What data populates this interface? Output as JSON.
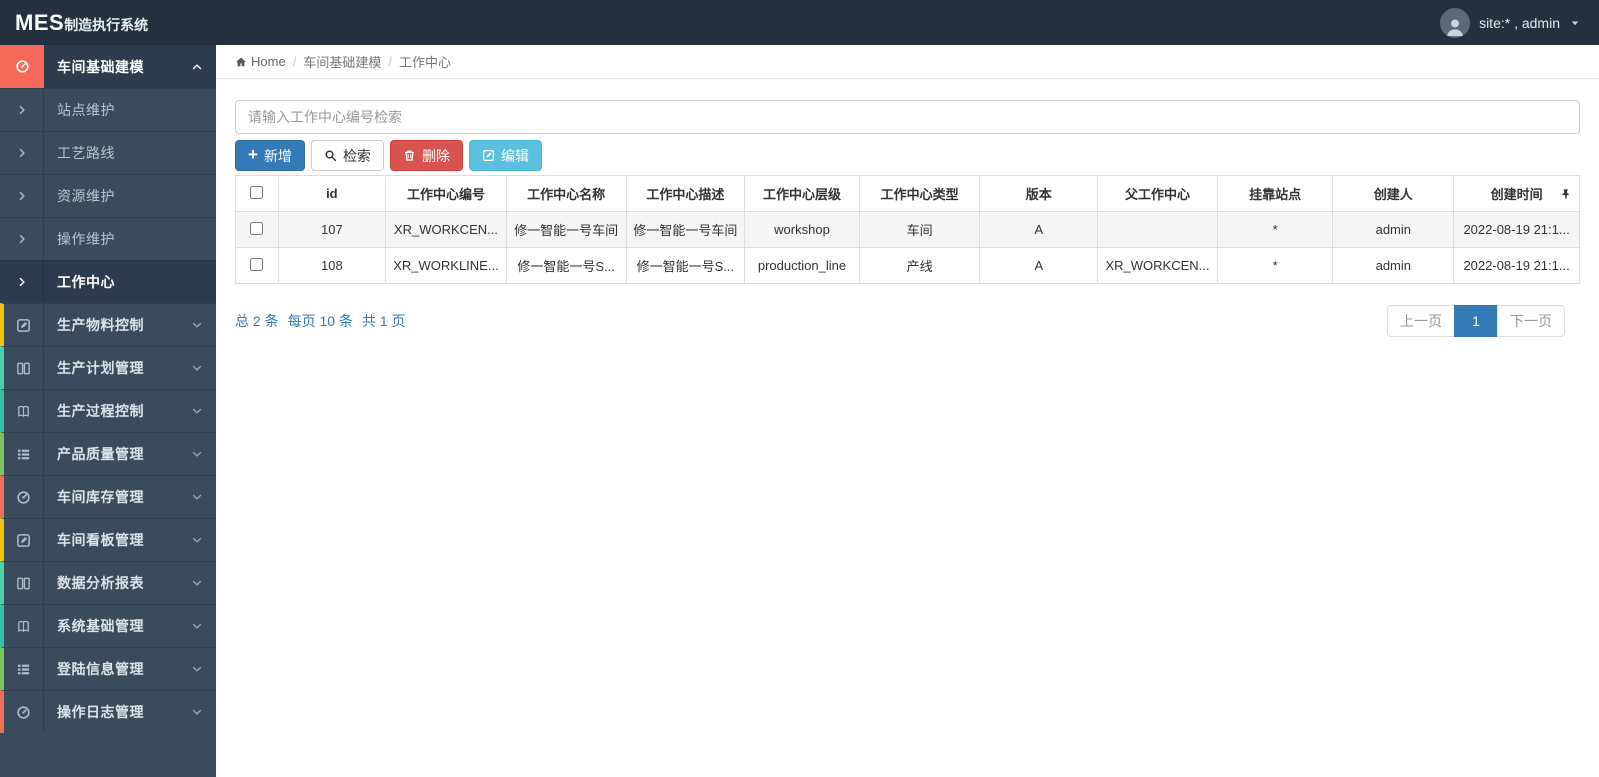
{
  "colors": {
    "topbar": "#243040",
    "sidebar": "#3a4b5d",
    "sidebarActive": "#2c3c4e",
    "brandRed": "#f4695a",
    "primary": "#337ab7",
    "primaryBorder": "#2e6da4",
    "danger": "#d9534f",
    "dangerBorder": "#d43f3a",
    "info": "#5bc0de",
    "infoBorder": "#46b8da",
    "link": "#337ab7",
    "tableBorder": "#dddddd",
    "stripe": "#f5f5f5"
  },
  "topbar": {
    "logo_bold": "MES",
    "logo_rest": "制造执行系统",
    "user_label": "site:* , admin"
  },
  "breadcrumb": {
    "home": "Home",
    "section": "车间基础建模",
    "current": "工作中心"
  },
  "search": {
    "placeholder": "请输入工作中心编号检索",
    "value": ""
  },
  "toolbar": {
    "add_label": "新增",
    "search_label": "检索",
    "delete_label": "删除",
    "edit_label": "编辑"
  },
  "sidebar": {
    "parent": {
      "label": "车间基础建模",
      "icon": "gauge-icon",
      "accent": "#f4695a"
    },
    "subitems": [
      {
        "label": "站点维护"
      },
      {
        "label": "工艺路线"
      },
      {
        "label": "资源维护"
      },
      {
        "label": "操作维护"
      },
      {
        "label": "工作中心",
        "active": true
      }
    ],
    "items": [
      {
        "label": "生产物料控制",
        "icon": "pencil-square-icon",
        "accent": "#f1c40f"
      },
      {
        "label": "生产计划管理",
        "icon": "columns-icon",
        "accent": "#4fd0ac"
      },
      {
        "label": "生产过程控制",
        "icon": "book-icon",
        "accent": "#35c2a4"
      },
      {
        "label": "产品质量管理",
        "icon": "th-list-icon",
        "accent": "#7cc35b"
      },
      {
        "label": "车间库存管理",
        "icon": "gauge-icon",
        "accent": "#ee6e5d"
      },
      {
        "label": "车间看板管理",
        "icon": "pencil-square-icon",
        "accent": "#f1c40f"
      },
      {
        "label": "数据分析报表",
        "icon": "columns-icon",
        "accent": "#4fd0ac"
      },
      {
        "label": "系统基础管理",
        "icon": "book-icon",
        "accent": "#35c2a4"
      },
      {
        "label": "登陆信息管理",
        "icon": "th-list-icon",
        "accent": "#7cc35b"
      },
      {
        "label": "操作日志管理",
        "icon": "gauge-icon",
        "accent": "#ee6e5d"
      }
    ]
  },
  "table": {
    "headers": [
      "id",
      "工作中心编号",
      "工作中心名称",
      "工作中心描述",
      "工作中心层级",
      "工作中心类型",
      "版本",
      "父工作中心",
      "挂靠站点",
      "创建人",
      "创建时间"
    ],
    "rows": [
      [
        "107",
        "XR_WORKCEN...",
        "修一智能一号车间",
        "修一智能一号车间",
        "workshop",
        "车间",
        "A",
        "",
        "*",
        "admin",
        "2022-08-19 21:1..."
      ],
      [
        "108",
        "XR_WORKLINE...",
        "修一智能一号S...",
        "修一智能一号S...",
        "production_line",
        "产线",
        "A",
        "XR_WORKCEN...",
        "*",
        "admin",
        "2022-08-19 21:1..."
      ]
    ]
  },
  "pagination": {
    "total": "总 2 条",
    "per_page": "每页 10 条",
    "pages": "共 1 页",
    "prev": "上一页",
    "page": "1",
    "next": "下一页"
  }
}
